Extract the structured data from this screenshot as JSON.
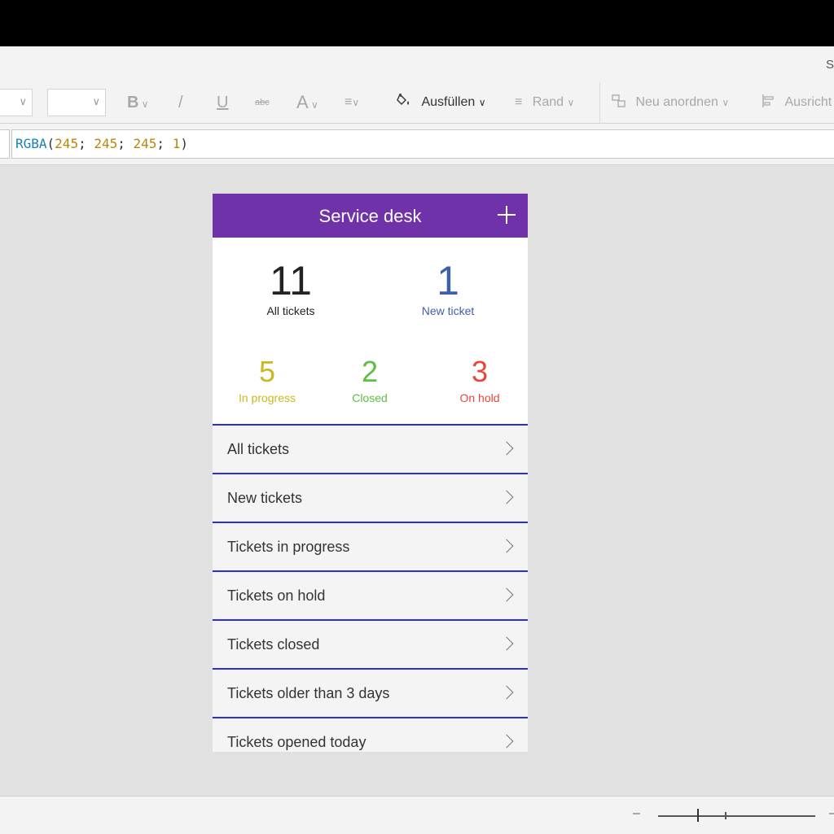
{
  "window": {
    "title_fragment": "S"
  },
  "toolbar": {
    "bold": "B",
    "italic": "/",
    "underline": "U",
    "strike": "abc",
    "font_color": "A",
    "fill_label": "Ausfüllen",
    "border_label": "Rand",
    "arrange_label": "Neu anordnen",
    "align_label": "Ausricht"
  },
  "formula": {
    "fn": "RGBA",
    "open": "(",
    "r": "245",
    "sep1": "; ",
    "g": "245",
    "sep2": "; ",
    "b": "245",
    "sep3": "; ",
    "a": "1",
    "close": ")"
  },
  "app": {
    "title": "Service desk",
    "stats": {
      "all": {
        "value": "11",
        "label": "All tickets",
        "color": "#222222"
      },
      "new": {
        "value": "1",
        "label": "New ticket",
        "color": "#3f5fa8"
      },
      "progress": {
        "value": "5",
        "label": "In progress",
        "color": "#c9b91e"
      },
      "closed": {
        "value": "2",
        "label": "Closed",
        "color": "#5cc040"
      },
      "hold": {
        "value": "3",
        "label": "On hold",
        "color": "#e8453c"
      }
    },
    "menu": [
      {
        "label": "All tickets"
      },
      {
        "label": "New tickets"
      },
      {
        "label": "Tickets in progress"
      },
      {
        "label": "Tickets on hold"
      },
      {
        "label": "Tickets closed"
      },
      {
        "label": "Tickets older than 3 days"
      },
      {
        "label": "Tickets opened today"
      }
    ]
  },
  "statusbar": {
    "zoom_minus": "–",
    "zoom_plus": "–"
  },
  "colors": {
    "header": "#6f32a8",
    "separator": "#2a2ae0",
    "canvas": "#e1e1e1",
    "row_bg": "#f4f4f4"
  }
}
